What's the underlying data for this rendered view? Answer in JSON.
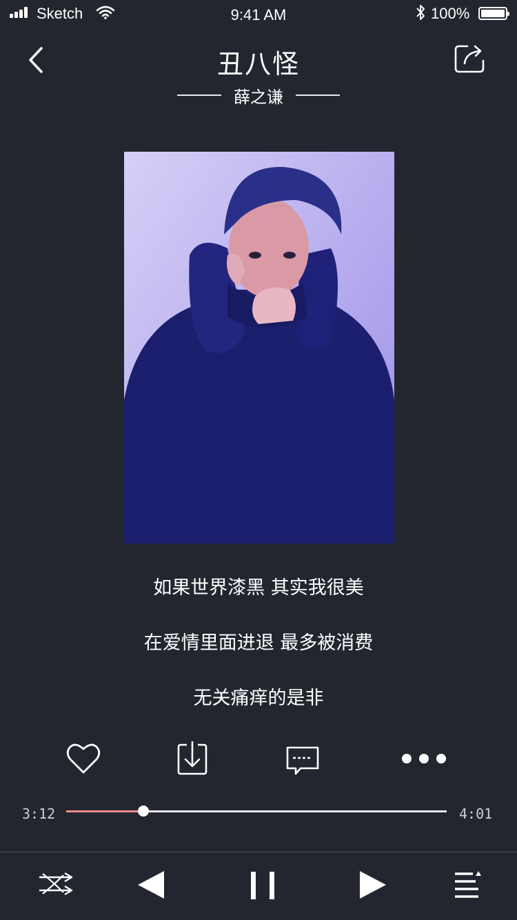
{
  "status_bar": {
    "carrier": "Sketch",
    "time": "9:41 AM",
    "battery_percent": "100%"
  },
  "header": {
    "title": "丑八怪",
    "artist": "薛之谦"
  },
  "lyrics": [
    "如果世界漆黑 其实我很美",
    "在爱情里面进退 最多被消费",
    "无关痛痒的是非"
  ],
  "actions": {
    "icons": [
      "heart-icon",
      "download-icon",
      "comment-icon",
      "more-icon"
    ]
  },
  "progress": {
    "elapsed": "3:12",
    "total": "4:01",
    "played_fraction": 0.203,
    "played_color": "#ef8d8d"
  },
  "controls": {
    "icons": [
      "shuffle-icon",
      "previous-icon",
      "pause-icon",
      "next-icon",
      "playlist-icon"
    ]
  },
  "colors": {
    "background": "#23262f",
    "accent": "#ef8d8d",
    "text": "#ffffff"
  }
}
